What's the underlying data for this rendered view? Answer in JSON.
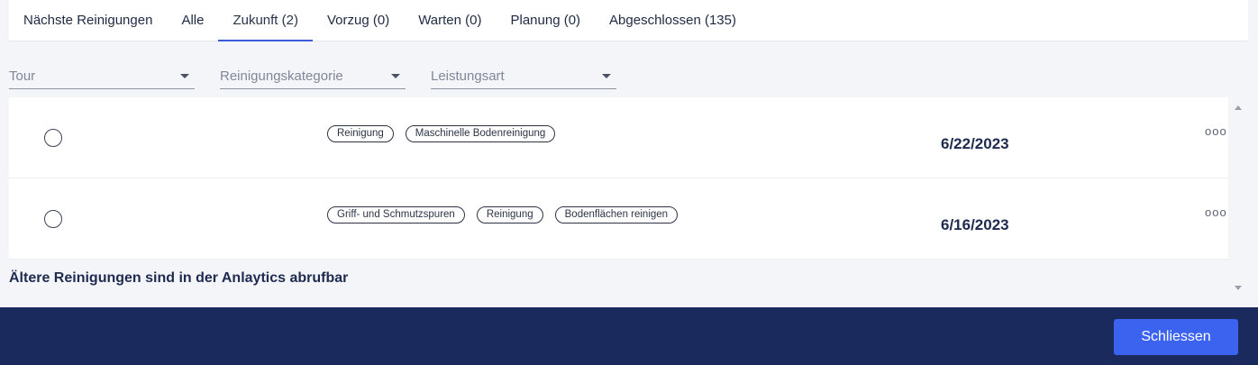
{
  "tabs": [
    {
      "label": "Nächste Reinigungen"
    },
    {
      "label": "Alle"
    },
    {
      "label": "Zukunft (2)"
    },
    {
      "label": "Vorzug (0)"
    },
    {
      "label": "Warten (0)"
    },
    {
      "label": "Planung (0)"
    },
    {
      "label": "Abgeschlossen (135)"
    }
  ],
  "filters": {
    "tour": "Tour",
    "category": "Reinigungskategorie",
    "service": "Leistungsart"
  },
  "rows": [
    {
      "tags": [
        "Reinigung",
        "Maschinelle Bodenreinigung"
      ],
      "date": "6/22/2023",
      "more": "ooo"
    },
    {
      "tags": [
        "Griff- und Schmutzspuren",
        "Reinigung",
        "Bodenflächen reinigen"
      ],
      "date": "6/16/2023",
      "more": "ooo"
    }
  ],
  "footer_note": "Ältere Reinigungen sind in der Anlaytics abrufbar",
  "close_label": "Schliessen",
  "colors": {
    "accent": "#3b63f0",
    "bottom_bar": "#1b2a5c",
    "tab_underline": "#3b5bdb"
  }
}
